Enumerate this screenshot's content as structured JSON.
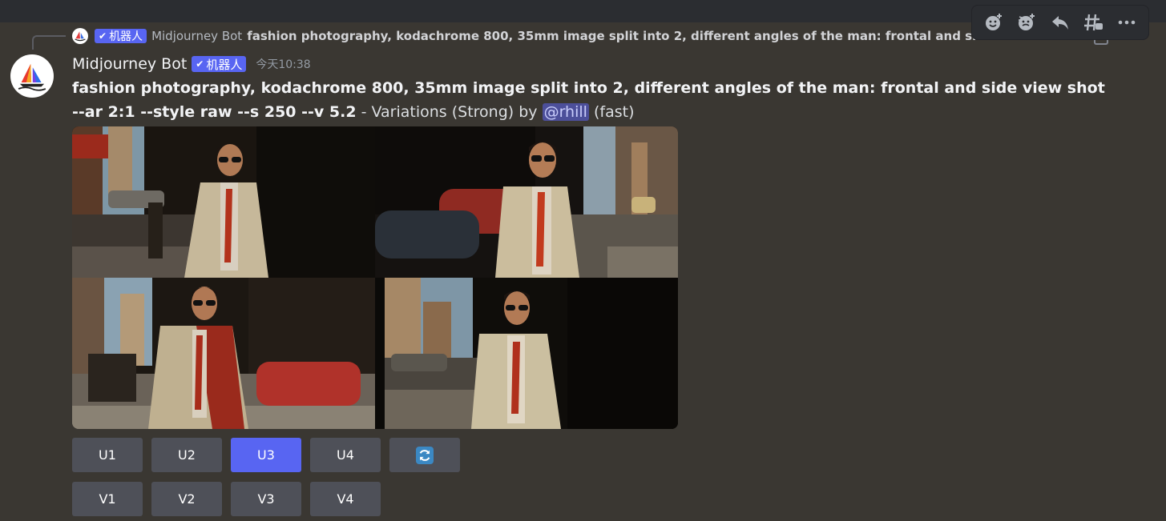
{
  "reply": {
    "bot_badge": "机器人",
    "author": "Midjourney Bot",
    "text": "fashion photography, kodachrome 800, 35mm image split into 2, different angles of the man: frontal and side view shot"
  },
  "message": {
    "author": "Midjourney Bot",
    "bot_badge": "机器人",
    "timestamp": "今天10:38",
    "prompt": "fashion photography, kodachrome 800, 35mm image split into 2, different angles of the man: frontal and side view shot --ar 2:1 --style raw --s 250 --v 5.2",
    "separator": " - ",
    "variation_text": "Variations (Strong) by ",
    "mention": "@rhill",
    "speed": " (fast)"
  },
  "actions": [
    "add-reaction-icon",
    "super-reaction-icon",
    "reply-icon",
    "create-thread-icon",
    "more-icon"
  ],
  "buttons_row1": [
    {
      "label": "U1",
      "active": false
    },
    {
      "label": "U2",
      "active": false
    },
    {
      "label": "U3",
      "active": true
    },
    {
      "label": "U4",
      "active": false
    }
  ],
  "buttons_row2": [
    {
      "label": "V1"
    },
    {
      "label": "V2"
    },
    {
      "label": "V3"
    },
    {
      "label": "V4"
    }
  ],
  "colors": {
    "background": "#3a3732",
    "button": "#4e5058",
    "button_active": "#5865f2",
    "badge": "#5865f2",
    "mention_bg": "#4c4f9a"
  }
}
